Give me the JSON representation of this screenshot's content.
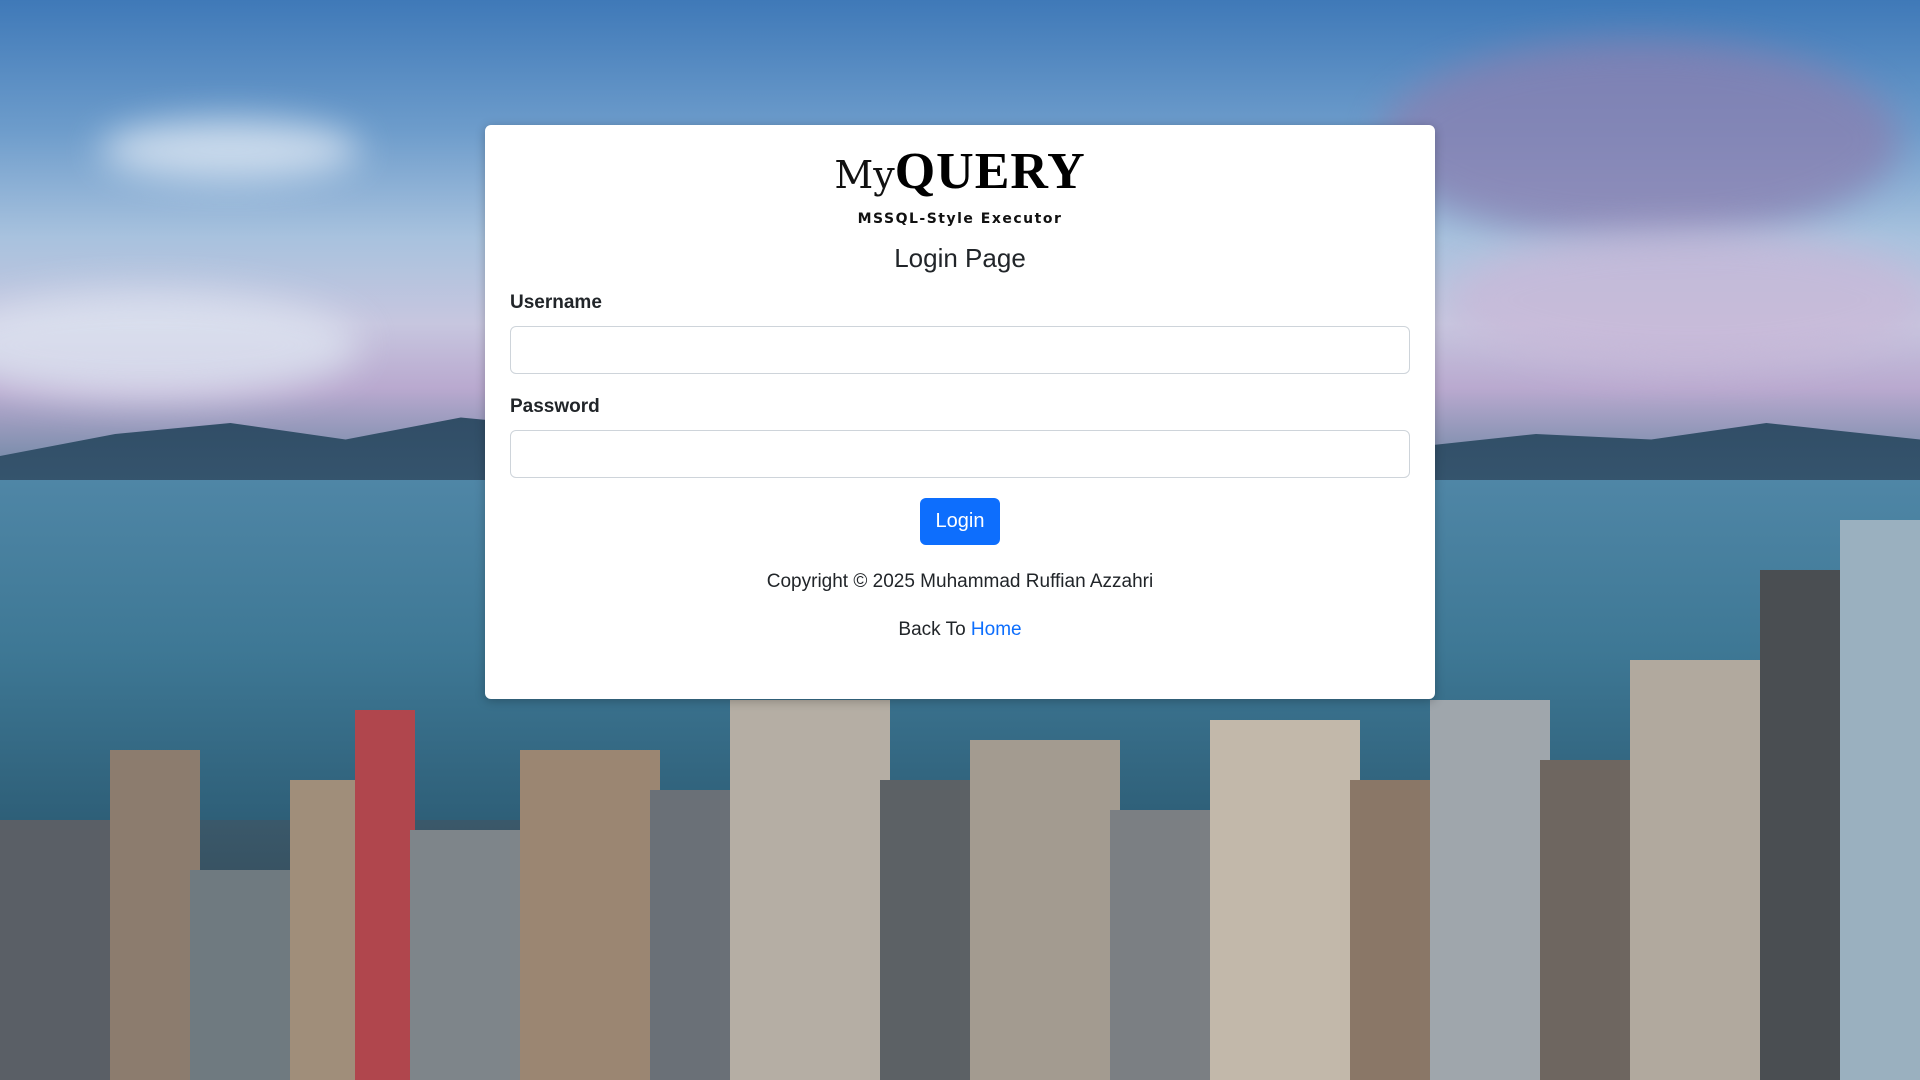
{
  "logo": {
    "my": "My",
    "query": "QUERY"
  },
  "subtitle": "MSSQL-Style Executor",
  "page_title": "Login Page",
  "form": {
    "username_label": "Username",
    "username_value": "",
    "password_label": "Password",
    "password_value": "",
    "login_button": "Login"
  },
  "footer": {
    "copyright": "Copyright © 2025 Muhammad Ruffian Azzahri",
    "back_prefix": "Back To ",
    "home_link": "Home"
  },
  "colors": {
    "primary": "#0d6efd",
    "card_bg": "#ffffff",
    "text": "#212529"
  },
  "background": {
    "icon": "city-skyline-photo"
  }
}
